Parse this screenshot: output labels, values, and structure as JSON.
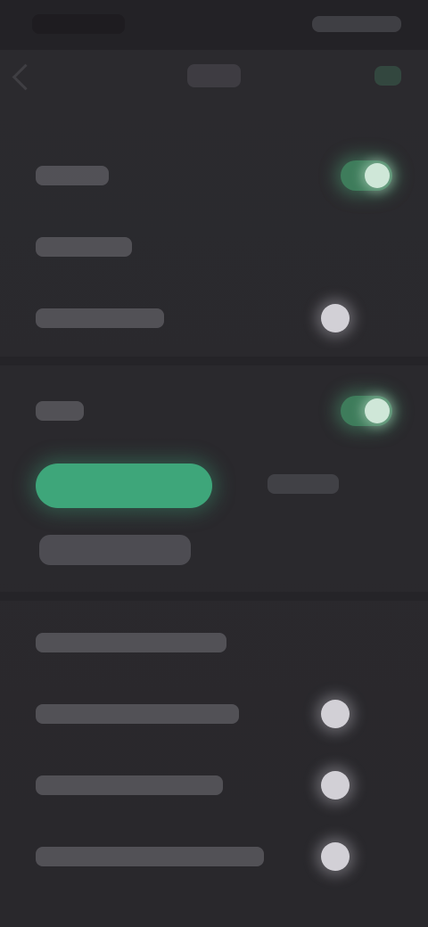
{
  "status_bar": {
    "time": "",
    "system_icons": ""
  },
  "app_bar": {
    "title": ""
  },
  "settings_rows": [
    {
      "label": "",
      "toggle": "on"
    },
    {
      "label": "",
      "toggle": "none"
    },
    {
      "label": "",
      "toggle": "off"
    },
    {
      "label": "",
      "toggle": "on"
    }
  ],
  "options": {
    "primary_option": "",
    "secondary_option": "",
    "sub_option": ""
  },
  "lower_rows": [
    {
      "label": "",
      "toggle": "none"
    },
    {
      "label": "",
      "toggle": "off"
    },
    {
      "label": "",
      "toggle": "off"
    },
    {
      "label": "",
      "toggle": "off"
    }
  ],
  "colors": {
    "background": "#2a292d",
    "accent_green": "#3ea67a",
    "toggle_knob": "#d2d0d6"
  },
  "icons": {
    "back": "back-arrow-icon",
    "confirm": "check-icon"
  }
}
